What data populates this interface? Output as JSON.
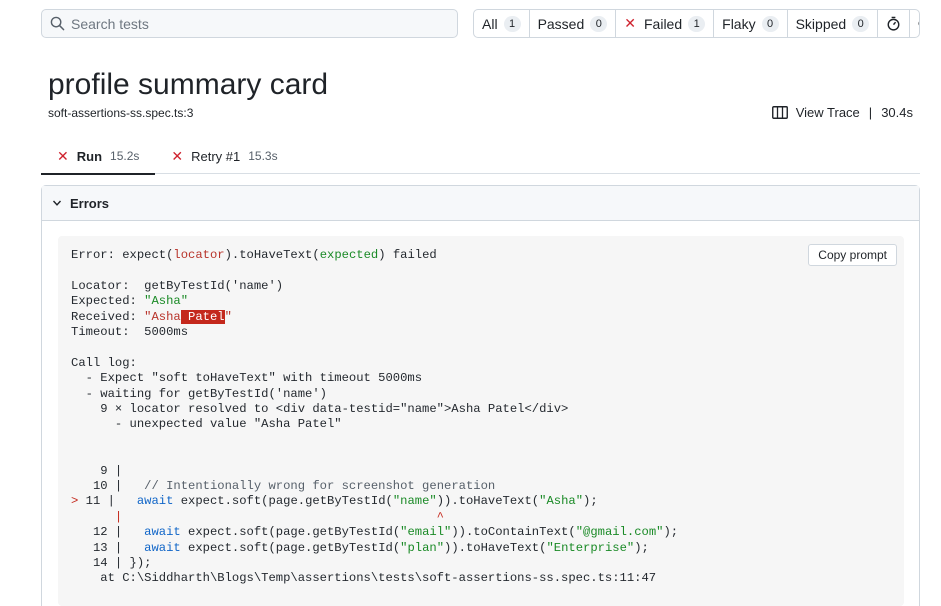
{
  "search": {
    "placeholder": "Search tests"
  },
  "filters": [
    {
      "label": "All",
      "count": "1"
    },
    {
      "label": "Passed",
      "count": "0"
    },
    {
      "label": "Failed",
      "count": "1"
    },
    {
      "label": "Flaky",
      "count": "0"
    },
    {
      "label": "Skipped",
      "count": "0"
    }
  ],
  "test": {
    "title": "profile summary card",
    "location": "soft-assertions-ss.spec.ts:3",
    "view_trace": "View Trace",
    "separator": "|",
    "duration": "30.4s"
  },
  "tabs": [
    {
      "label": "Run",
      "duration": "15.2s"
    },
    {
      "label": "Retry #1",
      "duration": "15.3s"
    }
  ],
  "errors": {
    "heading": "Errors",
    "copy_label": "Copy prompt",
    "message": {
      "prefix": "Error: expect(",
      "locator": "locator",
      "mid": ").toHaveText(",
      "expected": "expected",
      "suffix": ") failed"
    },
    "locator_line": "Locator:  getByTestId('name')",
    "expected_label": "Expected: ",
    "expected_value": "\"Asha\"",
    "received_label": "Received: ",
    "received_start": "\"Asha",
    "received_diff": " Patel",
    "received_end": "\"",
    "timeout_line": "Timeout:  5000ms",
    "call_log_title": "Call log:",
    "call_log": [
      "  - Expect \"soft toHaveText\" with timeout 5000ms",
      "  - waiting for getByTestId('name')",
      "    9 × locator resolved to <div data-testid=\"name\">Asha Patel</div>",
      "      - unexpected value \"Asha Patel\""
    ],
    "source": {
      "l9": "    9 |",
      "l10_prefix": "   10 |   ",
      "l10_comment": "// Intentionally wrong for screenshot generation",
      "l11_marker": "> ",
      "l11_prefix": "11 |   ",
      "await": "await",
      "l11_a": " expect.soft(page.getByTestId(",
      "l11_s1": "\"name\"",
      "l11_b": ")).toHaveText(",
      "l11_s2": "\"Asha\"",
      "l11_c": ");",
      "caret_line": "      |                                           ^",
      "l12_prefix": "   12 |   ",
      "l12_a": " expect.soft(page.getByTestId(",
      "l12_s1": "\"email\"",
      "l12_b": ")).toContainText(",
      "l12_s2": "\"@gmail.com\"",
      "l12_c": ");",
      "l13_prefix": "   13 |   ",
      "l13_a": " expect.soft(page.getByTestId(",
      "l13_s1": "\"plan\"",
      "l13_b": ")).toHaveText(",
      "l13_s2": "\"Enterprise\"",
      "l13_c": ");",
      "l14": "   14 | });",
      "at_line": "    at C:\\Siddharth\\Blogs\\Temp\\assertions\\tests\\soft-assertions-ss.spec.ts:11:47"
    }
  }
}
